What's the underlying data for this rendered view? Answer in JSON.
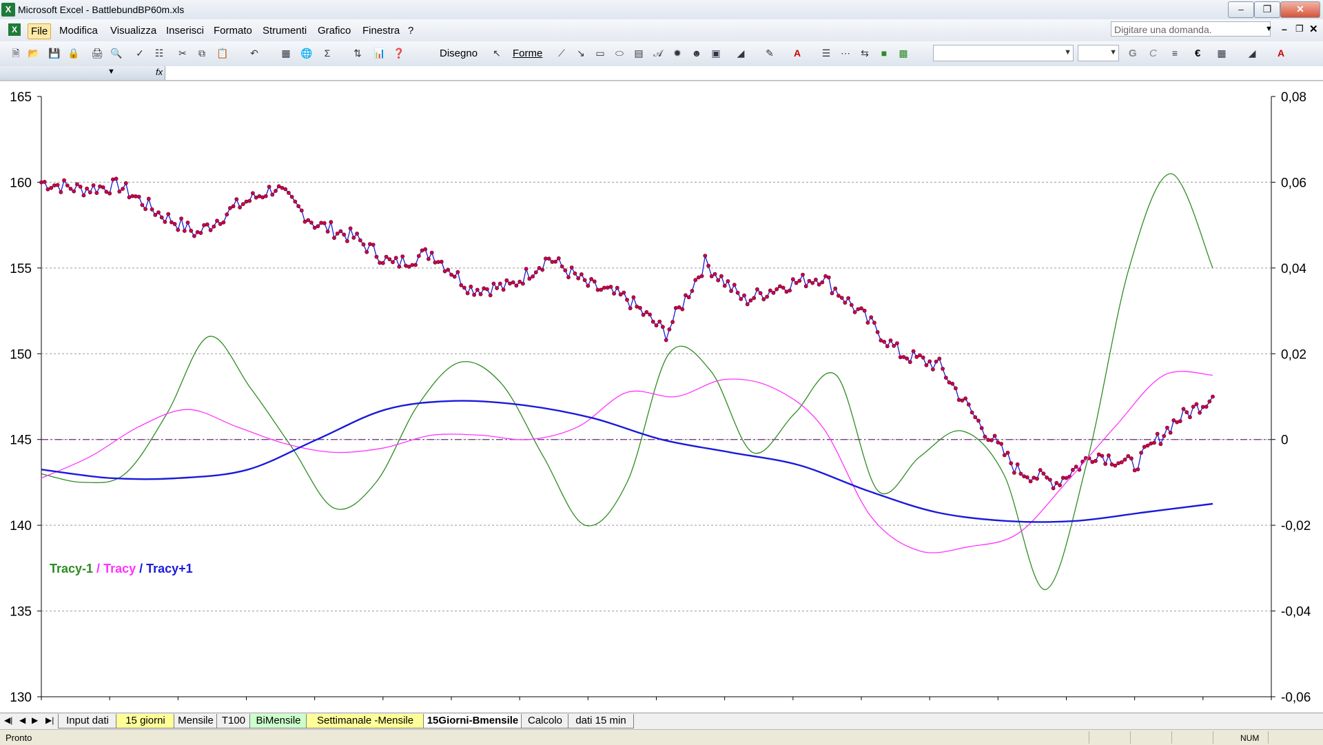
{
  "window": {
    "title": "Microsoft Excel - BattlebundBP60m.xls",
    "app_icon": "excel-icon",
    "buttons": [
      "minimize",
      "restore",
      "close"
    ]
  },
  "menu": {
    "items": [
      "File",
      "Modifica",
      "Visualizza",
      "Inserisci",
      "Formato",
      "Strumenti",
      "Grafico",
      "Finestra",
      "?"
    ],
    "ask_placeholder": "Digitare una domanda."
  },
  "toolbar": {
    "draw_label": "Disegno",
    "shapes_label": "Forme",
    "bold_label": "G",
    "italic_label": "C",
    "euro_label": "€"
  },
  "formula": {
    "fx": "fx"
  },
  "chart_data": {
    "type": "line",
    "title": "",
    "legend": [
      {
        "name": "Tracy-1",
        "color": "#2e8b22"
      },
      {
        "name": "Tracy",
        "color": "#ff33ff"
      },
      {
        "name": "Tracy+1",
        "color": "#1a1adb"
      }
    ],
    "legend_placement": "middle-left",
    "y_left": {
      "min": 130,
      "max": 165,
      "ticks": [
        "130",
        "135",
        "140",
        "145",
        "150",
        "155",
        "160",
        "165"
      ]
    },
    "y_right": {
      "min": -0.06,
      "max": 0.08,
      "ticks": [
        "-0,06",
        "-0,04",
        "-0,02",
        "0",
        "0,02",
        "0,04",
        "0,06",
        "0,08"
      ]
    },
    "grid": "horizontal dashed",
    "zero_line_color": "#6a2a7a",
    "x": [
      0,
      4,
      8,
      12,
      16,
      20,
      24,
      28,
      32,
      36,
      40,
      44,
      48,
      52,
      56,
      60,
      64,
      68,
      72,
      76,
      80,
      84,
      88,
      92,
      96,
      100
    ],
    "series": [
      {
        "name": "Price",
        "axis": "left",
        "color": "#1a1adb",
        "marker_color": "#cc0044",
        "values": [
          160.0,
          159.6,
          159.8,
          158.2,
          157.0,
          158.6,
          159.7,
          157.6,
          156.8,
          155.2,
          155.9,
          153.8,
          153.9,
          155.6,
          154.0,
          153.2,
          151.2,
          155.3,
          153.1,
          154.0,
          154.5,
          152.3,
          150.0,
          149.3,
          146.0,
          143.2,
          142.5,
          144.2,
          143.5,
          146.0,
          147.5
        ]
      },
      {
        "name": "Tracy-1",
        "axis": "right",
        "color": "#2e8b22",
        "values": [
          -0.008,
          -0.01,
          -0.008,
          0.006,
          0.024,
          0.012,
          -0.002,
          -0.016,
          -0.01,
          0.008,
          0.018,
          0.013,
          -0.004,
          -0.02,
          -0.01,
          0.02,
          0.016,
          -0.003,
          0.006,
          0.015,
          -0.012,
          -0.004,
          0.002,
          -0.008,
          -0.035,
          -0.005,
          0.04,
          0.062,
          0.04
        ]
      },
      {
        "name": "Tracy",
        "axis": "right",
        "color": "#ff33ff",
        "values": [
          -0.009,
          -0.004,
          0.003,
          0.007,
          0.003,
          -0.001,
          -0.003,
          -0.002,
          0.001,
          0.001,
          0.0,
          0.003,
          0.011,
          0.01,
          0.014,
          0.012,
          0.003,
          -0.018,
          -0.026,
          -0.025,
          -0.022,
          -0.01,
          0.003,
          0.015,
          0.015
        ]
      },
      {
        "name": "Tracy+1",
        "axis": "right",
        "color": "#1a1adb",
        "values": [
          -0.007,
          -0.009,
          -0.009,
          -0.007,
          0.0,
          0.007,
          0.009,
          0.008,
          0.005,
          0.0,
          -0.003,
          -0.006,
          -0.012,
          -0.017,
          -0.019,
          -0.019,
          -0.017,
          -0.015
        ]
      }
    ]
  },
  "sheets": {
    "tabs": [
      {
        "label": "Input dati",
        "color": "#f0f0f0",
        "active": false
      },
      {
        "label": "15 giorni",
        "color": "#ffff99",
        "active": false
      },
      {
        "label": "Mensile",
        "color": "#f0f0f0",
        "active": false
      },
      {
        "label": "T100",
        "color": "#f0f0f0",
        "active": false
      },
      {
        "label": "BiMensile",
        "color": "#ccffcc",
        "active": false
      },
      {
        "label": "Settimanale -Mensile",
        "color": "#ffff99",
        "active": false
      },
      {
        "label": "15Giorni-Bmensile",
        "color": "#ffffff",
        "active": true
      },
      {
        "label": "Calcolo",
        "color": "#f0f0f0",
        "active": false
      },
      {
        "label": "dati 15 min",
        "color": "#f0f0f0",
        "active": false
      }
    ]
  },
  "status": {
    "text": "Pronto",
    "num": "NUM"
  }
}
